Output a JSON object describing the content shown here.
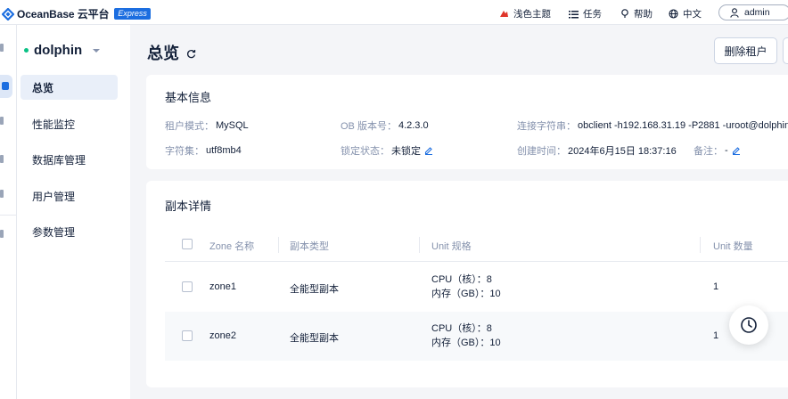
{
  "topbar": {
    "brand": "OceanBase 云平台",
    "badge": "Express",
    "theme_label": "浅色主题",
    "tasks_label": "任务",
    "help_label": "帮助",
    "lang_label": "中文",
    "user_label": "admin",
    "accent": "#1c6ee0"
  },
  "sidebar": {
    "tenant_name": "dolphin",
    "items": [
      {
        "label": "总览"
      },
      {
        "label": "性能监控"
      },
      {
        "label": "数据库管理"
      },
      {
        "label": "用户管理"
      },
      {
        "label": "参数管理"
      }
    ]
  },
  "header": {
    "title": "总览",
    "delete_tenant_label": "删除租户"
  },
  "basic_info": {
    "title": "基本信息",
    "tenant_mode_label": "租户模式：",
    "tenant_mode_value": "MySQL",
    "ob_version_label": "OB 版本号：",
    "ob_version_value": "4.2.3.0",
    "conn_label": "连接字符串：",
    "conn_value": "obclient -h192.168.31.19 -P2881 -uroot@dolphin",
    "charset_label": "字符集：",
    "charset_value": "utf8mb4",
    "lock_label": "锁定状态：",
    "lock_value": "未锁定",
    "created_label": "创建时间：",
    "created_value": "2024年6月15日 18:37:16",
    "remark_label": "备注：",
    "remark_value": "-"
  },
  "replica": {
    "title": "副本详情",
    "columns": [
      "Zone 名称",
      "副本类型",
      "Unit 规格",
      "Unit 数量"
    ],
    "rows": [
      {
        "zone": "zone1",
        "type": "全能型副本",
        "cpu": "CPU（核）：8",
        "mem": "内存（GB）：10",
        "count": "1"
      },
      {
        "zone": "zone2",
        "type": "全能型副本",
        "cpu": "CPU（核）：8",
        "mem": "内存（GB）：10",
        "count": "1"
      }
    ]
  }
}
